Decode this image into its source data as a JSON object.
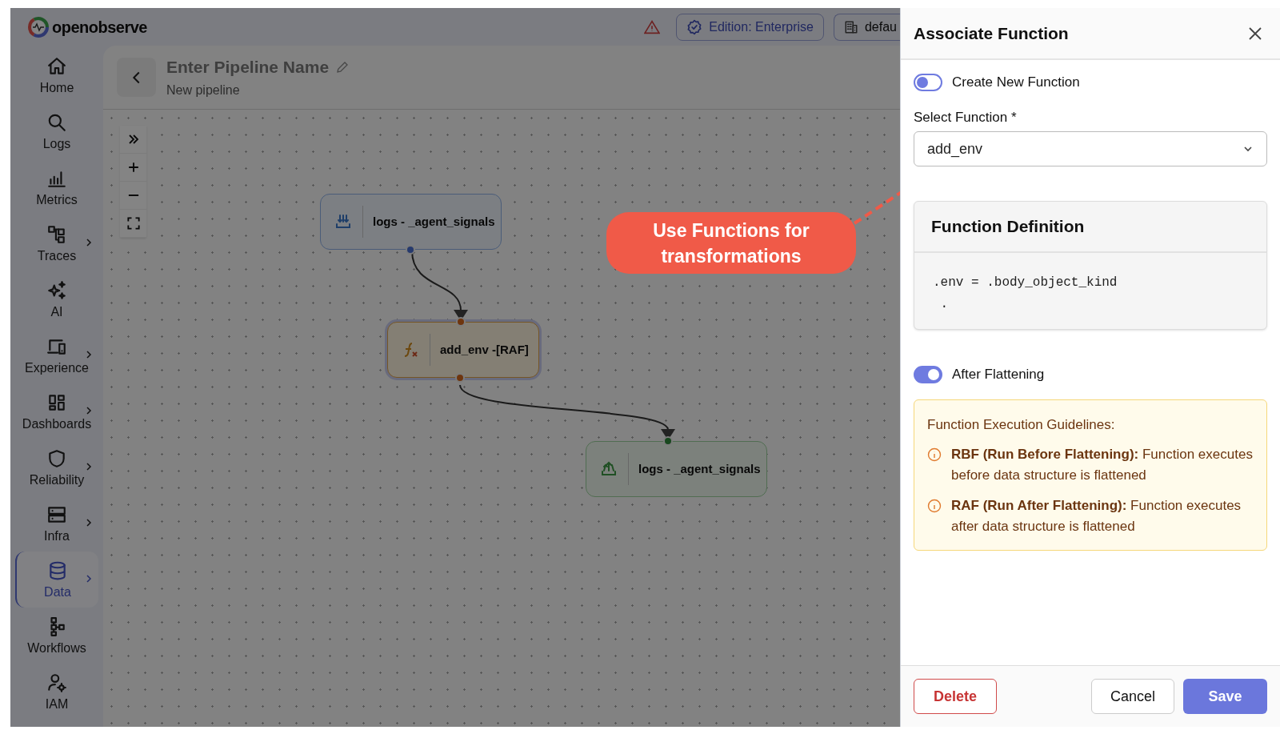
{
  "brand": {
    "name": "openobserve"
  },
  "top_bar": {
    "edition_badge": "Edition: Enterprise",
    "org_selector": "defau"
  },
  "sidebar": {
    "items": [
      {
        "label": "Home",
        "selected": false,
        "has_submenu": false
      },
      {
        "label": "Logs",
        "selected": false,
        "has_submenu": false
      },
      {
        "label": "Metrics",
        "selected": false,
        "has_submenu": false
      },
      {
        "label": "Traces",
        "selected": false,
        "has_submenu": true
      },
      {
        "label": "AI",
        "selected": false,
        "has_submenu": false
      },
      {
        "label": "Experience",
        "selected": false,
        "has_submenu": true
      },
      {
        "label": "Dashboards",
        "selected": false,
        "has_submenu": true
      },
      {
        "label": "Reliability",
        "selected": false,
        "has_submenu": true
      },
      {
        "label": "Infra",
        "selected": false,
        "has_submenu": true
      },
      {
        "label": "Data",
        "selected": true,
        "has_submenu": true
      },
      {
        "label": "Workflows",
        "selected": false,
        "has_submenu": false
      },
      {
        "label": "IAM",
        "selected": false,
        "has_submenu": false
      }
    ]
  },
  "pipeline": {
    "title": "Enter Pipeline Name",
    "subtitle": "New pipeline"
  },
  "canvas": {
    "nodes": [
      {
        "kind": "source",
        "label": "logs - _agent_signals"
      },
      {
        "kind": "function",
        "label": "add_env -[RAF]"
      },
      {
        "kind": "destination",
        "label": "logs - _agent_signals"
      }
    ]
  },
  "callout": {
    "text": "Use Functions for transformations"
  },
  "panel": {
    "title": "Associate Function",
    "create_new_toggle": {
      "label": "Create New Function",
      "on": false
    },
    "select": {
      "label": "Select Function *",
      "value": "add_env"
    },
    "definition": {
      "title": "Function Definition",
      "code_lines": [
        ".env = .body_object_kind",
        " ."
      ]
    },
    "after_flattening_toggle": {
      "label": "After Flattening",
      "on": true
    },
    "guidelines": {
      "title": "Function Execution Guidelines:",
      "items": [
        "**RBF (Run Before Flattening):** Function executes before data structure is flattened",
        "**RAF (Run After Flattening):** Function executes after data structure is flattened"
      ]
    },
    "buttons": {
      "delete": "Delete",
      "cancel": "Cancel",
      "save": "Save"
    }
  }
}
